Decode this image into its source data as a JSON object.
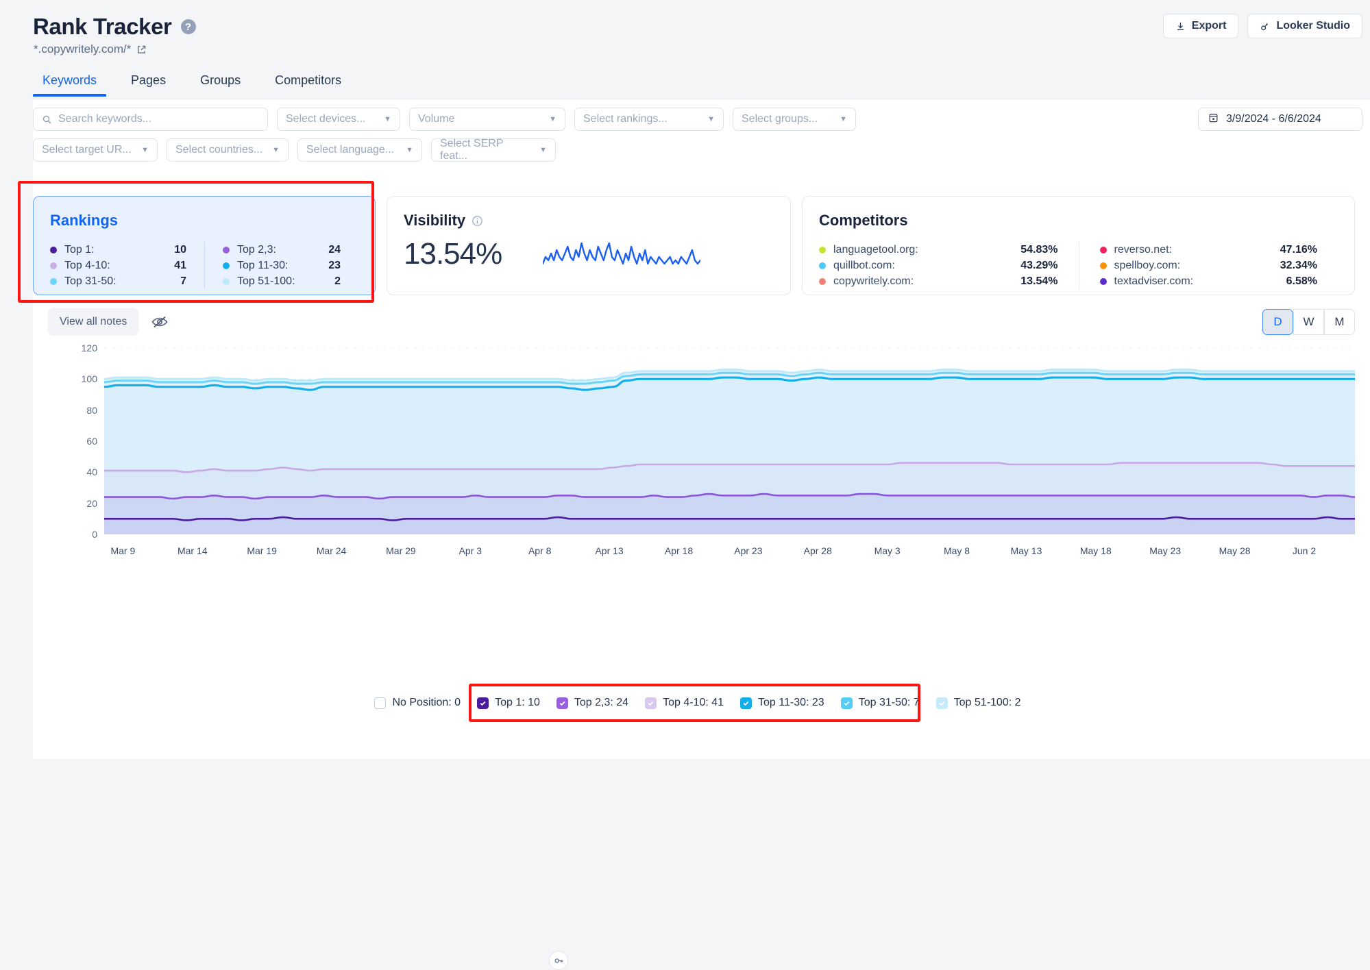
{
  "header": {
    "title": "Rank Tracker",
    "help_icon": "question-mark-icon",
    "domain": "*.copywritely.com/*",
    "external_link_icon": "external-link-icon",
    "export_label": "Export",
    "looker_label": "Looker Studio"
  },
  "tabs": [
    {
      "label": "Keywords",
      "active": true
    },
    {
      "label": "Pages",
      "active": false
    },
    {
      "label": "Groups",
      "active": false
    },
    {
      "label": "Competitors",
      "active": false
    }
  ],
  "filters": {
    "search_placeholder": "Search keywords...",
    "devices": "Select devices...",
    "volume": "Volume",
    "rankings": "Select rankings...",
    "groups": "Select groups...",
    "target_url": "Select target UR...",
    "countries": "Select countries...",
    "language": "Select language...",
    "serp_features": "Select SERP feat...",
    "date_range": "3/9/2024 - 6/6/2024"
  },
  "rankings_card": {
    "title": "Rankings",
    "highlighted": true,
    "left": [
      {
        "label": "Top 1:",
        "value": "10",
        "color": "#4b1c9e"
      },
      {
        "label": "Top 4-10:",
        "value": "41",
        "color": "#c6b0e8"
      },
      {
        "label": "Top 31-50:",
        "value": "7",
        "color": "#6dd4f7"
      }
    ],
    "right": [
      {
        "label": "Top 2,3:",
        "value": "24",
        "color": "#9761dc"
      },
      {
        "label": "Top 11-30:",
        "value": "23",
        "color": "#14aeeb"
      },
      {
        "label": "Top 51-100:",
        "value": "2",
        "color": "#bfe9f9"
      }
    ]
  },
  "visibility_card": {
    "title": "Visibility",
    "info_icon": "info-icon",
    "value": "13.54%",
    "sparkline_color": "#1b5ff0"
  },
  "competitors_card": {
    "title": "Competitors",
    "left": [
      {
        "label": "languagetool.org:",
        "value": "54.83%",
        "color": "#c6e330"
      },
      {
        "label": "quillbot.com:",
        "value": "43.29%",
        "color": "#4ec8f5"
      },
      {
        "label": "copywritely.com:",
        "value": "13.54%",
        "color": "#ef8174"
      }
    ],
    "right": [
      {
        "label": "reverso.net:",
        "value": "47.16%",
        "color": "#f1235c"
      },
      {
        "label": "spellboy.com:",
        "value": "32.34%",
        "color": "#fb9007"
      },
      {
        "label": "textadviser.com:",
        "value": "6.58%",
        "color": "#5b2bc6"
      }
    ]
  },
  "chart_toolbar": {
    "notes_label": "View all notes",
    "eye_off_icon": "eye-off-icon",
    "granularity": [
      {
        "label": "D",
        "selected": true
      },
      {
        "label": "W",
        "selected": false
      },
      {
        "label": "M",
        "selected": false
      }
    ]
  },
  "note_marker_icon": "key-icon",
  "legend": {
    "no_position": {
      "label": "No Position: 0",
      "checked": false,
      "color": "#ffffff"
    },
    "highlighted": true,
    "items": [
      {
        "label": "Top 1: 10",
        "checked": true,
        "color": "#4b1c9e"
      },
      {
        "label": "Top 2,3: 24",
        "checked": true,
        "color": "#9761dc"
      },
      {
        "label": "Top 4-10: 41",
        "checked": true,
        "color": "#d8c8f0"
      },
      {
        "label": "Top 11-30: 23",
        "checked": true,
        "color": "#14aeeb"
      },
      {
        "label": "Top 31-50: 7",
        "checked": true,
        "color": "#6dd4f7"
      },
      {
        "label": "Top 51-100: 2",
        "checked": true,
        "color": "#bfe9f9"
      }
    ]
  },
  "chart_data": {
    "type": "area",
    "stacked": true,
    "title": "",
    "xlabel": "",
    "ylabel": "",
    "ylim": [
      0,
      120
    ],
    "yticks": [
      0,
      20,
      40,
      60,
      80,
      100,
      120
    ],
    "grid": true,
    "legend_position": "bottom",
    "x_tick_labels": [
      "Mar 9",
      "Mar 14",
      "Mar 19",
      "Mar 24",
      "Mar 29",
      "Apr 3",
      "Apr 8",
      "Apr 13",
      "Apr 18",
      "Apr 23",
      "Apr 28",
      "May 3",
      "May 8",
      "May 13",
      "May 18",
      "May 23",
      "May 28",
      "Jun 2"
    ],
    "series": [
      {
        "name": "Top 1",
        "color": "#4b1c9e",
        "fill": "#c9d2f2",
        "values": [
          10,
          10,
          10,
          10,
          10,
          10,
          9,
          10,
          10,
          10,
          9,
          10,
          10,
          11,
          10,
          10,
          10,
          10,
          10,
          10,
          10,
          9,
          10,
          10,
          10,
          10,
          10,
          10,
          10,
          10,
          10,
          10,
          10,
          11,
          10,
          10,
          10,
          10,
          10,
          10,
          10,
          10,
          10,
          10,
          10,
          10,
          10,
          10,
          10,
          10,
          10,
          10,
          10,
          10,
          10,
          10,
          10,
          10,
          10,
          10,
          10,
          10,
          10,
          10,
          10,
          10,
          10,
          10,
          10,
          10,
          10,
          10,
          10,
          10,
          10,
          10,
          10,
          10,
          11,
          10,
          10,
          10,
          10,
          10,
          10,
          10,
          10,
          10,
          10,
          11,
          10,
          10
        ]
      },
      {
        "name": "Top 2,3",
        "color": "#8a55d8",
        "fill": "#ccd8f3",
        "values": [
          24,
          24,
          24,
          24,
          24,
          23,
          24,
          24,
          25,
          24,
          24,
          23,
          24,
          24,
          24,
          24,
          25,
          24,
          24,
          24,
          23,
          24,
          24,
          24,
          24,
          24,
          24,
          25,
          24,
          24,
          24,
          24,
          24,
          25,
          25,
          24,
          24,
          24,
          24,
          24,
          25,
          24,
          24,
          25,
          26,
          25,
          25,
          25,
          26,
          25,
          25,
          25,
          25,
          25,
          25,
          26,
          26,
          25,
          25,
          25,
          25,
          25,
          25,
          25,
          25,
          25,
          25,
          25,
          25,
          25,
          25,
          25,
          25,
          25,
          25,
          25,
          25,
          25,
          25,
          25,
          25,
          25,
          25,
          25,
          25,
          25,
          25,
          25,
          24,
          25,
          25,
          24
        ]
      },
      {
        "name": "Top 4-10",
        "color": "#c8a8e6",
        "fill": "#d9e8f9",
        "values": [
          41,
          41,
          41,
          41,
          41,
          41,
          40,
          41,
          42,
          41,
          41,
          41,
          42,
          43,
          42,
          41,
          42,
          42,
          42,
          42,
          42,
          42,
          42,
          42,
          42,
          42,
          42,
          42,
          42,
          42,
          42,
          42,
          42,
          42,
          42,
          42,
          42,
          43,
          44,
          45,
          45,
          45,
          45,
          45,
          45,
          45,
          45,
          45,
          45,
          45,
          45,
          45,
          45,
          45,
          45,
          45,
          45,
          45,
          46,
          46,
          46,
          46,
          46,
          46,
          46,
          46,
          45,
          45,
          45,
          45,
          45,
          45,
          45,
          45,
          46,
          46,
          46,
          46,
          46,
          46,
          46,
          46,
          46,
          46,
          46,
          45,
          44,
          44,
          44,
          44,
          44,
          44
        ]
      },
      {
        "name": "Top 11-30",
        "color": "#14aeeb",
        "fill": "#daeefb",
        "values": [
          95,
          96,
          96,
          96,
          95,
          95,
          95,
          95,
          96,
          95,
          95,
          94,
          95,
          95,
          94,
          93,
          95,
          95,
          95,
          95,
          95,
          95,
          95,
          95,
          95,
          95,
          95,
          95,
          95,
          95,
          95,
          95,
          95,
          95,
          94,
          93,
          94,
          95,
          99,
          100,
          100,
          100,
          100,
          100,
          100,
          101,
          101,
          100,
          100,
          100,
          99,
          100,
          101,
          100,
          100,
          100,
          100,
          100,
          100,
          100,
          100,
          101,
          101,
          100,
          100,
          100,
          100,
          100,
          100,
          101,
          101,
          101,
          101,
          100,
          100,
          100,
          100,
          100,
          101,
          101,
          100,
          100,
          100,
          100,
          100,
          100,
          100,
          100,
          100,
          100,
          100,
          100
        ]
      },
      {
        "name": "Top 31-50",
        "color": "#6dd4f7",
        "fill": "#e4f3fc",
        "values": [
          98,
          99,
          99,
          99,
          98,
          98,
          98,
          98,
          99,
          98,
          98,
          97,
          98,
          98,
          97,
          97,
          98,
          98,
          98,
          98,
          98,
          98,
          98,
          98,
          98,
          98,
          98,
          98,
          98,
          98,
          98,
          98,
          98,
          98,
          97,
          97,
          98,
          99,
          102,
          103,
          103,
          103,
          103,
          103,
          103,
          104,
          104,
          103,
          103,
          103,
          102,
          103,
          104,
          103,
          103,
          103,
          103,
          103,
          103,
          103,
          103,
          104,
          104,
          103,
          103,
          103,
          103,
          103,
          103,
          104,
          104,
          104,
          104,
          103,
          103,
          103,
          103,
          103,
          104,
          104,
          103,
          103,
          103,
          103,
          103,
          103,
          103,
          103,
          103,
          103,
          103,
          103
        ]
      },
      {
        "name": "Top 51-100",
        "color": "#bfe9f9",
        "fill": "#eef8fd",
        "values": [
          100,
          101,
          101,
          101,
          100,
          100,
          100,
          100,
          101,
          100,
          100,
          99,
          100,
          100,
          99,
          99,
          100,
          100,
          100,
          100,
          100,
          100,
          100,
          100,
          100,
          100,
          100,
          100,
          100,
          100,
          100,
          100,
          100,
          100,
          99,
          99,
          100,
          101,
          104,
          105,
          105,
          105,
          105,
          105,
          105,
          106,
          106,
          105,
          105,
          105,
          104,
          105,
          106,
          105,
          105,
          105,
          105,
          105,
          105,
          105,
          105,
          106,
          106,
          105,
          105,
          105,
          105,
          105,
          105,
          106,
          106,
          106,
          106,
          105,
          105,
          105,
          105,
          105,
          106,
          106,
          105,
          105,
          105,
          105,
          105,
          105,
          105,
          105,
          105,
          105,
          105,
          105
        ]
      }
    ],
    "visibility_sparkline": [
      12,
      14,
      13,
      15,
      13,
      16,
      14,
      13,
      15,
      17,
      14,
      13,
      16,
      14,
      18,
      15,
      13,
      16,
      14,
      13,
      17,
      15,
      13,
      16,
      18,
      14,
      13,
      16,
      14,
      12,
      15,
      13,
      17,
      14,
      12,
      15,
      13,
      16,
      12,
      14,
      13,
      12,
      14,
      13,
      12,
      13,
      14,
      12,
      13,
      12,
      14,
      13,
      12,
      14,
      16,
      13,
      12,
      13
    ]
  }
}
